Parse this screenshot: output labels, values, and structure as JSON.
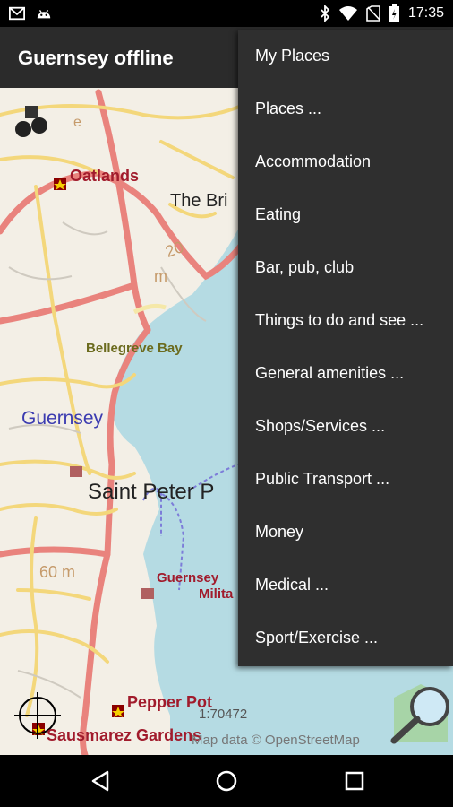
{
  "status_bar": {
    "time": "17:35",
    "left_icons": [
      "gmail-icon",
      "android-icon"
    ],
    "right_icons": [
      "bluetooth-icon",
      "wifi-icon",
      "no-sim-icon",
      "battery-icon"
    ]
  },
  "app_bar": {
    "title": "Guernsey offline"
  },
  "map": {
    "labels": {
      "oatlands": "Oatlands",
      "the_bridge": "The Bri",
      "bellegreve_bay": "Bellegreve Bay",
      "guernsey": "Guernsey",
      "saint_peter": "Saint Peter P",
      "guernsey_museum": "Guernsey",
      "militia": "Milita",
      "pepper_pot": "Pepper Pot",
      "sausmarez": "Sausmarez Gardens",
      "contour_20": "20",
      "contour_m": "m",
      "contour_60": "60 m",
      "contour_e": "e"
    },
    "scale": "1:70472",
    "attribution": "Map data © OpenStreetMap",
    "colors": {
      "sea": "#b5dbe3",
      "land": "#f3efe6",
      "major_road": "#e9837d",
      "secondary_road": "#f3d77b"
    }
  },
  "menu": {
    "items": [
      "My Places",
      "Places ...",
      "Accommodation",
      "Eating",
      "Bar, pub, club",
      "Things to do and see ...",
      "General amenities ...",
      "Shops/Services ...",
      "Public Transport ...",
      "Money",
      "Medical ...",
      "Sport/Exercise ..."
    ]
  },
  "nav_bar": {
    "buttons": [
      "back-icon",
      "home-icon",
      "recents-icon"
    ]
  }
}
